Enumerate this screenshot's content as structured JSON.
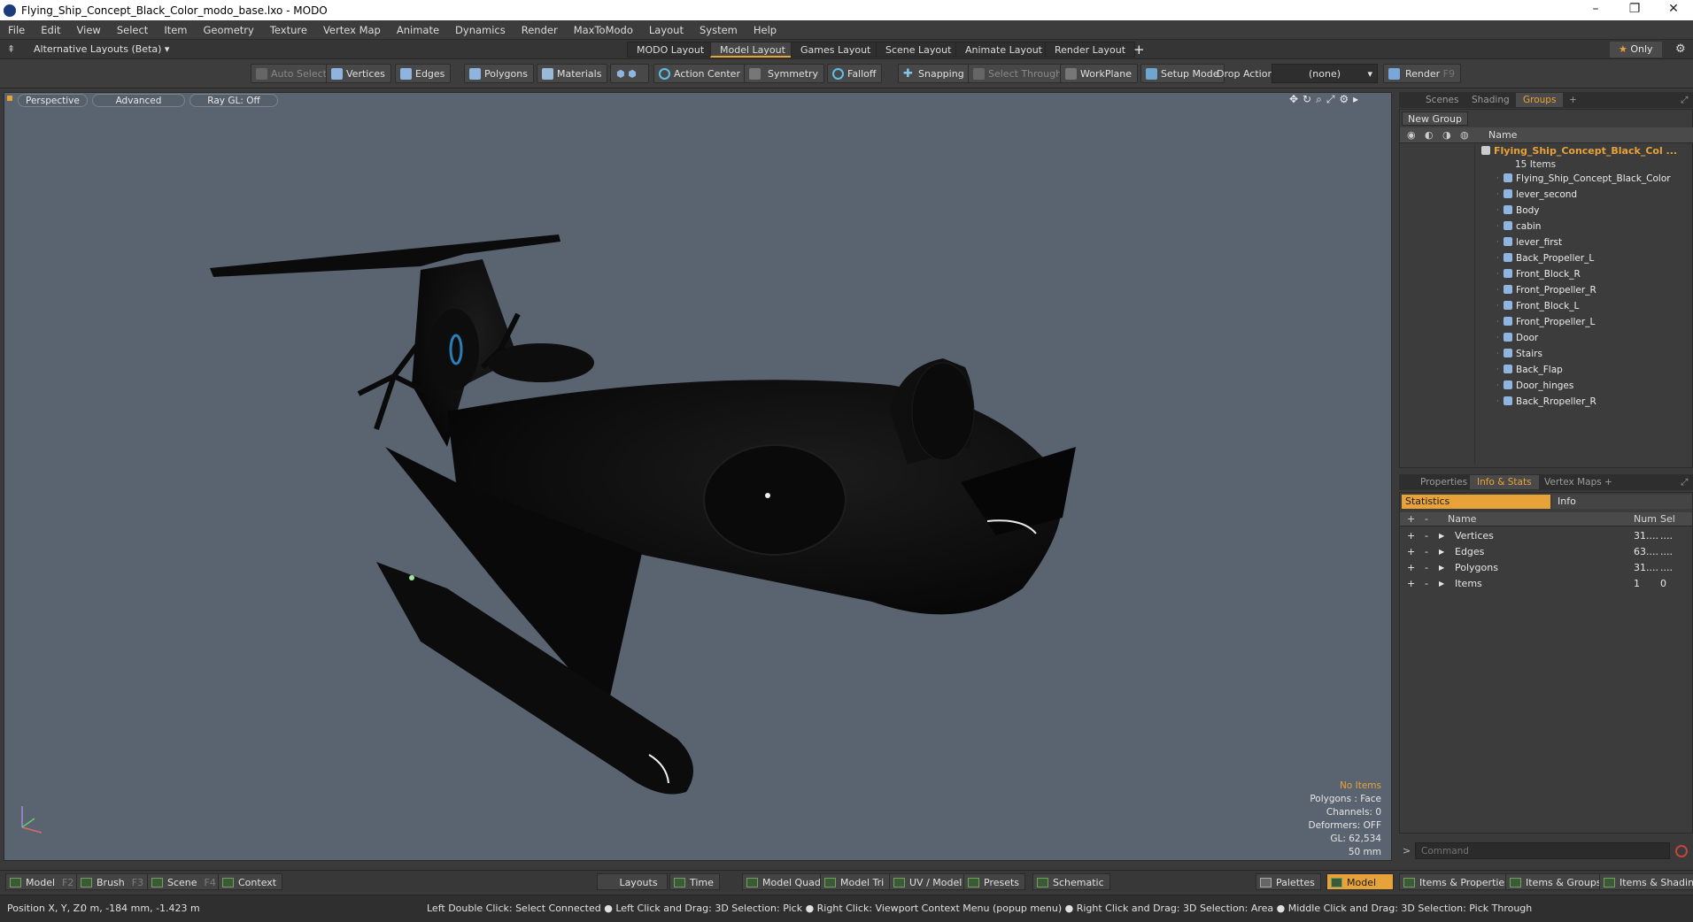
{
  "window": {
    "title": "Flying_Ship_Concept_Black_Color_modo_base.lxo - MODO",
    "controls": [
      "–",
      "❐",
      "✕"
    ]
  },
  "menu": [
    "File",
    "Edit",
    "View",
    "Select",
    "Item",
    "Geometry",
    "Texture",
    "Vertex Map",
    "Animate",
    "Dynamics",
    "Render",
    "MaxToModo",
    "Layout",
    "System",
    "Help"
  ],
  "layouts": {
    "alternative": "Alternative Layouts (Beta)",
    "tabs": [
      "MODO Layout",
      "Model Layout",
      "Games Layout",
      "Scene Layout",
      "Animate Layout",
      "Render Layout"
    ],
    "active": "Model Layout",
    "add": "+",
    "only": "Only"
  },
  "toolbar": {
    "auto_select": "Auto Select",
    "vertices": "Vertices",
    "edges": "Edges",
    "polygons": "Polygons",
    "materials": "Materials",
    "action_center": "Action Center",
    "symmetry": "Symmetry",
    "falloff": "Falloff",
    "snapping": "Snapping",
    "select_through": "Select Through",
    "workplane": "WorkPlane",
    "setup_mode": "Setup Mode",
    "drop_action_label": "Drop Action",
    "drop_action_value": "(none)",
    "render": "Render",
    "render_key": "F9"
  },
  "viewport": {
    "perspective": "Perspective",
    "advanced": "Advanced",
    "raygl": "Ray GL: Off",
    "hud": {
      "items": "No Items",
      "polygons": "Polygons : Face",
      "channels": "Channels: 0",
      "deformers": "Deformers: OFF",
      "gl": "GL: 62,534",
      "scale": "50 mm"
    }
  },
  "groups_panel": {
    "tabs": [
      "Scenes",
      "Shading",
      "Groups"
    ],
    "active": "Groups",
    "new_group": "New Group",
    "column": "Name",
    "root": "Flying_Ship_Concept_Black_Col ...",
    "root_count": "15 Items",
    "items": [
      "Flying_Ship_Concept_Black_Color",
      "lever_second",
      "Body",
      "cabin",
      "lever_first",
      "Back_Propeller_L",
      "Front_Block_R",
      "Front_Propeller_R",
      "Front_Block_L",
      "Front_Propeller_L",
      "Door",
      "Stairs",
      "Back_Flap",
      "Door_hinges",
      "Back_Rropeller_R"
    ]
  },
  "stats_panel": {
    "tabs": [
      "Properties",
      "Info & Stats",
      "Vertex Maps"
    ],
    "active": "Info & Stats",
    "statistics": "Statistics",
    "info": "Info",
    "columns": {
      "name": "Name",
      "num": "Num",
      "sel": "Sel"
    },
    "rows": [
      {
        "name": "Vertices",
        "num": "31....",
        "sel": "...."
      },
      {
        "name": "Edges",
        "num": "63....",
        "sel": "...."
      },
      {
        "name": "Polygons",
        "num": "31....",
        "sel": "...."
      },
      {
        "name": "Items",
        "num": "1",
        "sel": "0"
      }
    ],
    "command_placeholder": "Command"
  },
  "bottom": {
    "model": "Model",
    "model_key": "F2",
    "brush": "Brush",
    "brush_key": "F3",
    "scene": "Scene",
    "scene_key": "F4",
    "context": "Context",
    "layouts": "Layouts",
    "time": "Time",
    "model_quad": "Model Quad",
    "model_tri": "Model Tri",
    "uv_model": "UV / Model",
    "presets": "Presets",
    "schematic": "Schematic",
    "palettes": "Palettes",
    "model_active": "Model",
    "items_properties": "Items & Properties",
    "items_groups": "Items & Groups",
    "items_shading": "Items & Shading"
  },
  "status": {
    "position_label": "Position X, Y, Z:",
    "position_value": "0 m, -184 mm, -1.423 m",
    "hint": "Left Double Click: Select Connected ● Left Click and Drag: 3D Selection: Pick ● Right Click: Viewport Context Menu (popup menu) ● Right Click and Drag: 3D Selection: Area ● Middle Click and Drag: 3D Selection: Pick Through"
  },
  "colors": {
    "accent": "#e8a23a",
    "viewport_bg": "#5a6470"
  }
}
